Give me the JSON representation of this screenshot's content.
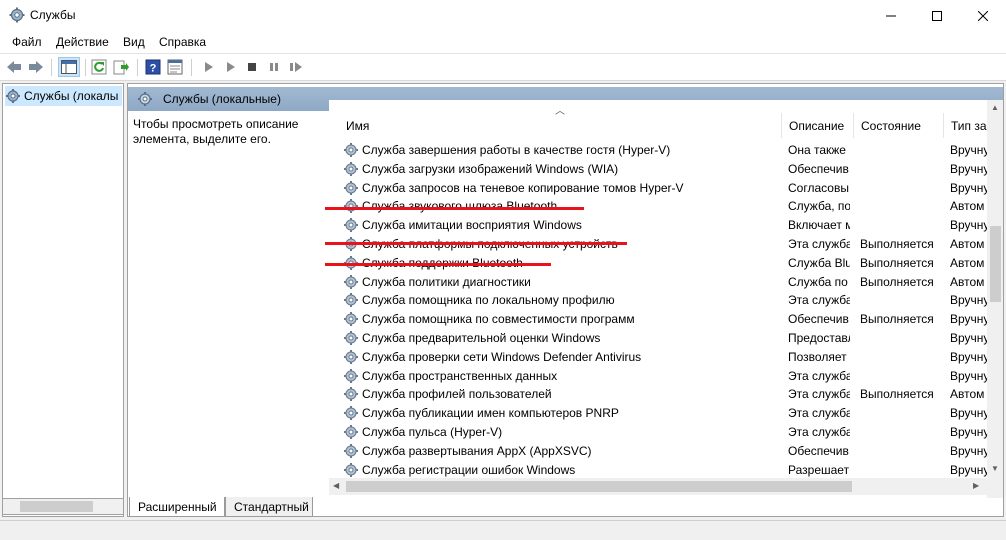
{
  "window": {
    "title": "Службы"
  },
  "menu": [
    "Файл",
    "Действие",
    "Вид",
    "Справка"
  ],
  "tree": {
    "selected_label": "Службы (локалы"
  },
  "panel": {
    "header": "Службы (локальные)",
    "description": "Чтобы просмотреть описание элемента, выделите его."
  },
  "columns": {
    "name": "Имя",
    "description": "Описание",
    "state": "Состояние",
    "startup": "Тип за"
  },
  "services": [
    {
      "name": "Служба завершения работы в качестве гостя (Hyper-V)",
      "desc": "Она также",
      "state": "",
      "type": "Вручну"
    },
    {
      "name": "Служба загрузки изображений Windows (WIA)",
      "desc": "Обеспечив",
      "state": "",
      "type": "Вручну"
    },
    {
      "name": "Служба запросов на теневое копирование томов Hyper-V",
      "desc": "Согласовы",
      "state": "",
      "type": "Вручну"
    },
    {
      "name": "Служба звукового шлюза Bluetooth",
      "desc": "Служба, по",
      "state": "",
      "type": "Автом"
    },
    {
      "name": "Служба имитации восприятия Windows",
      "desc": "Включает м",
      "state": "",
      "type": "Вручну"
    },
    {
      "name": "Служба платформы подключенных устройств",
      "desc": "Эта служба",
      "state": "Выполняется",
      "type": "Автом"
    },
    {
      "name": "Служба поддержки Bluetooth",
      "desc": "Служба Blu",
      "state": "Выполняется",
      "type": "Автом"
    },
    {
      "name": "Служба политики диагностики",
      "desc": "Служба по",
      "state": "Выполняется",
      "type": "Автом"
    },
    {
      "name": "Служба помощника по локальному профилю",
      "desc": "Эта служба",
      "state": "",
      "type": "Вручну"
    },
    {
      "name": "Служба помощника по совместимости программ",
      "desc": "Обеспечив",
      "state": "Выполняется",
      "type": "Вручну"
    },
    {
      "name": "Служба предварительной оценки Windows",
      "desc": "Предоставл",
      "state": "",
      "type": "Вручну"
    },
    {
      "name": "Служба проверки сети Windows Defender Antivirus",
      "desc": "Позволяет з",
      "state": "",
      "type": "Вручну"
    },
    {
      "name": "Служба пространственных данных",
      "desc": "Эта служба",
      "state": "",
      "type": "Вручну"
    },
    {
      "name": "Служба профилей пользователей",
      "desc": "Эта служба",
      "state": "Выполняется",
      "type": "Автом"
    },
    {
      "name": "Служба публикации имен компьютеров PNRP",
      "desc": "Эта служба",
      "state": "",
      "type": "Вручну"
    },
    {
      "name": "Служба пульса (Hyper-V)",
      "desc": "Эта служба",
      "state": "",
      "type": "Вручну"
    },
    {
      "name": "Служба развертывания AppX (AppXSVC)",
      "desc": "Обеспечив",
      "state": "",
      "type": "Вручну"
    },
    {
      "name": "Служба регистрации ошибок Windows",
      "desc": "Разрешает",
      "state": "",
      "type": "Вручну"
    }
  ],
  "tabs": {
    "extended": "Расширенный",
    "standard": "Стандартный"
  },
  "colors": {
    "header_strip": "#93adc9",
    "highlight_line": "#e8131b",
    "tree_selection": "#cce8ff"
  }
}
